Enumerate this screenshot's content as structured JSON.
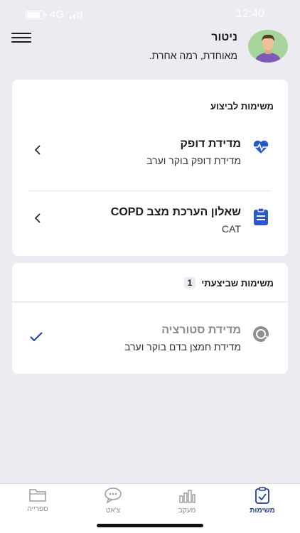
{
  "status": {
    "network": "4G",
    "time": "12:40"
  },
  "header": {
    "name": "ניטור",
    "subtitle": "מאוחדת, רמה אחרת."
  },
  "todo": {
    "title": "משימות לביצוע",
    "tasks": [
      {
        "title": "מדידת דופק",
        "subtitle": "מדידת דופק בוקר וערב",
        "icon": "heart-pulse-icon"
      },
      {
        "title": "שאלון הערכת מצב COPD",
        "subtitle": "CAT",
        "icon": "clipboard-icon"
      }
    ]
  },
  "done": {
    "title": "משימות שביצעתי",
    "count": "1",
    "tasks": [
      {
        "title": "מדידת סטורציה",
        "subtitle": "מדידת חמצן בדם בוקר וערב",
        "icon": "oxygen-icon"
      }
    ]
  },
  "tabs": [
    {
      "label": "משימות",
      "icon": "tasks-icon",
      "active": true
    },
    {
      "label": "מעקב",
      "icon": "chart-icon",
      "active": false
    },
    {
      "label": "צ'אט",
      "icon": "chat-icon",
      "active": false
    },
    {
      "label": "ספרייה",
      "icon": "folder-icon",
      "active": false
    }
  ],
  "colors": {
    "accent": "#1f3f94",
    "heart": "#2a58c9",
    "background": "#ECEBF1"
  }
}
